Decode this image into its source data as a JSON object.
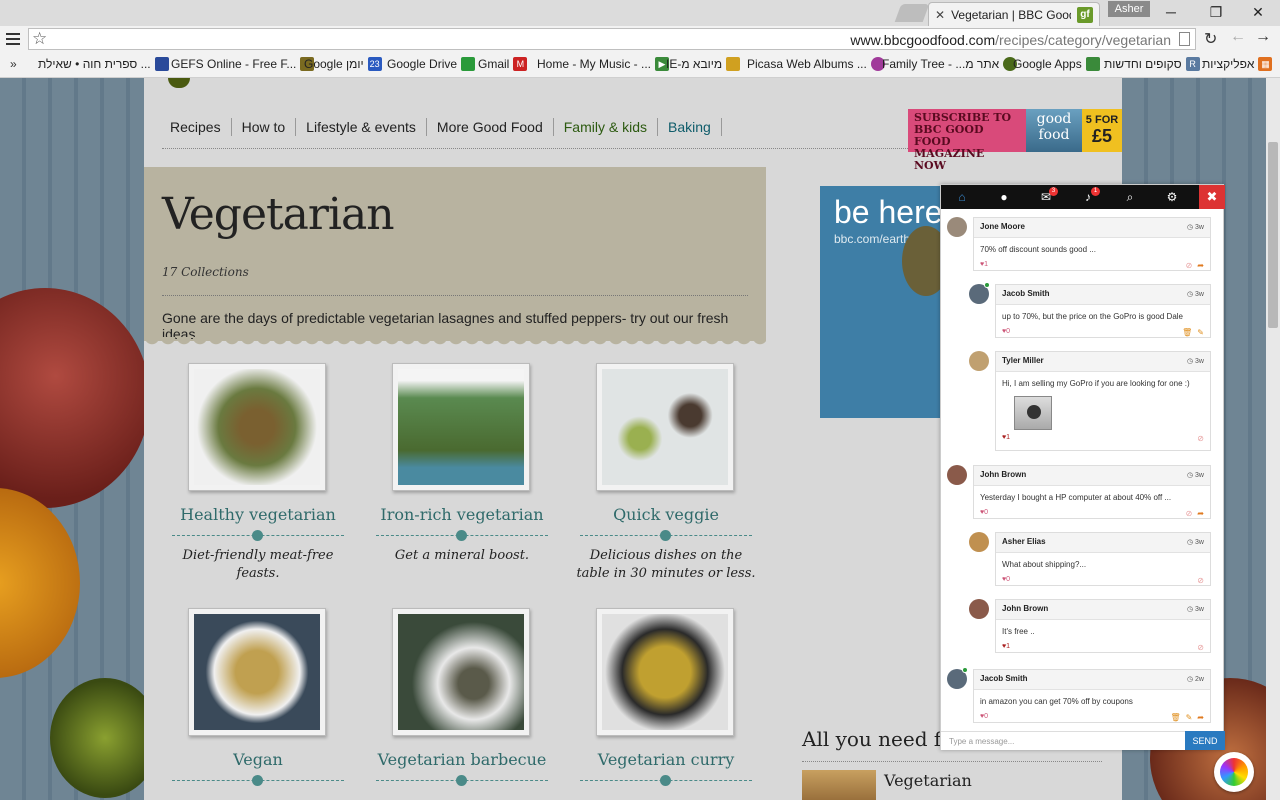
{
  "browser": {
    "tab_title": "Vegetarian | BBC Good Fo",
    "tab_favicon": "gf",
    "profile_name": "Asher",
    "url_domain": "www.bbcgoodfood.com",
    "url_path": "/recipes/category/vegetarian",
    "bookmarks": [
      {
        "label": "ספרית חוה • שאילת ...",
        "icon": "clock-icon",
        "color": "#2a4a9a"
      },
      {
        "label": "GEFS Online - Free F...",
        "icon": "plane-icon",
        "color": "#7a6a20"
      },
      {
        "label": "Google יומן",
        "icon": "calendar-icon",
        "color": "#2a5ac0"
      },
      {
        "label": "Google Drive",
        "icon": "drive-icon",
        "color": "#2a9a3a"
      },
      {
        "label": "Gmail",
        "icon": "gmail-icon",
        "color": "#c22"
      },
      {
        "label": "Home - My Music - ...",
        "icon": "play-icon",
        "color": "#3a8a3a"
      },
      {
        "label": "IE-מיובא מ",
        "icon": "folder-icon",
        "color": "#d0a020"
      },
      {
        "label": "Picasa Web Albums ...",
        "icon": "picasa-icon",
        "color": "#a03a9a"
      },
      {
        "label": "Family Tree - ...אתר מ",
        "icon": "tree-icon",
        "color": "#4a6a1a"
      },
      {
        "label": "Google Apps",
        "icon": "apps-icon",
        "color": "#3a8a3a"
      },
      {
        "label": "סקופים וחדשות",
        "icon": "news-icon",
        "color": "#5a7aa0"
      },
      {
        "label": "אפליקציות",
        "icon": "apps-grid-icon",
        "color": "#e07020"
      }
    ]
  },
  "site": {
    "nav": [
      {
        "label": "Recipes",
        "tone": "default"
      },
      {
        "label": "How to",
        "tone": "default"
      },
      {
        "label": "Lifestyle & events",
        "tone": "default"
      },
      {
        "label": "More Good Food",
        "tone": "default"
      },
      {
        "label": "Family & kids",
        "tone": "green"
      },
      {
        "label": "Baking",
        "tone": "teal"
      }
    ],
    "promo": {
      "text": "Subscribe to BBC Good Food magazine now",
      "mag": "good food",
      "price_top": "5 FOR",
      "price": "£5"
    },
    "hero": {
      "title": "Vegetarian",
      "count": "17 Collections",
      "description": "Gone are the days of predictable vegetarian lasagnes and stuffed peppers- try out our fresh ideas."
    },
    "collections": [
      {
        "title": "Healthy vegetarian",
        "desc": "Diet-friendly meat-free feasts.",
        "tone": "#6a7a40"
      },
      {
        "title": "Iron-rich vegetarian",
        "desc": "Get a mineral boost.",
        "tone": "#5a8a50"
      },
      {
        "title": "Quick veggie",
        "desc": "Delicious dishes on the table in 30 minutes or less.",
        "tone": "#8aa080"
      },
      {
        "title": "Vegan",
        "desc": "",
        "tone": "#a08040"
      },
      {
        "title": "Vegetarian barbecue",
        "desc": "",
        "tone": "#7a8a60"
      },
      {
        "title": "Vegetarian curry",
        "desc": "",
        "tone": "#a09040"
      }
    ],
    "ad": {
      "headline": "be here",
      "sub": "bbc.com/earth"
    },
    "sidebar": {
      "heading": "All you need fo",
      "item": "Vegetarian"
    }
  },
  "chat": {
    "tabs": [
      {
        "icon": "home-icon",
        "badge": ""
      },
      {
        "icon": "user-icon",
        "badge": ""
      },
      {
        "icon": "chat-icon",
        "badge": "3"
      },
      {
        "icon": "bell-icon",
        "badge": "1"
      },
      {
        "icon": "search-icon",
        "badge": ""
      },
      {
        "icon": "gear-icon",
        "badge": ""
      }
    ],
    "messages": [
      {
        "name": "Jone Moore",
        "time": "3w",
        "text": "70% off discount sounds good ...",
        "likes": "1",
        "liked": false,
        "reply": false,
        "actions": [
          "ban",
          "share"
        ],
        "avatar_color": "#9a8a7a",
        "online": false
      },
      {
        "name": "Jacob Smith",
        "time": "3w",
        "text": "up to 70%, but the price on the GoPro is good Dale",
        "likes": "0",
        "liked": false,
        "reply": true,
        "actions": [
          "trash",
          "edit"
        ],
        "avatar_color": "#5a6a7a",
        "online": true
      },
      {
        "name": "Tyler Miller",
        "time": "3w",
        "text": "Hi, I am selling my GoPro if you are looking for one :)",
        "likes": "1",
        "liked": true,
        "reply": true,
        "actions": [
          "ban"
        ],
        "avatar_color": "#c0a070",
        "online": false,
        "image": true
      },
      {
        "name": "John Brown",
        "time": "3w",
        "text": "Yesterday I bought a HP computer at about 40% off ...",
        "likes": "0",
        "liked": false,
        "reply": false,
        "actions": [
          "ban",
          "share"
        ],
        "avatar_color": "#8a5a4a",
        "online": false
      },
      {
        "name": "Asher Elias",
        "time": "3w",
        "text": "What about shipping?...",
        "likes": "0",
        "liked": false,
        "reply": true,
        "actions": [
          "ban"
        ],
        "avatar_color": "#c09050",
        "online": false
      },
      {
        "name": "John Brown",
        "time": "3w",
        "text": "It's free ..",
        "likes": "1",
        "liked": true,
        "reply": true,
        "actions": [
          "ban"
        ],
        "avatar_color": "#8a5a4a",
        "online": false
      },
      {
        "name": "Jacob Smith",
        "time": "2w",
        "text": "in amazon you can get 70% off by coupons",
        "likes": "0",
        "liked": false,
        "reply": false,
        "actions": [
          "trash",
          "edit",
          "share"
        ],
        "avatar_color": "#5a6a7a",
        "online": true
      }
    ],
    "input_placeholder": "Type a message...",
    "send_label": "SEND"
  }
}
